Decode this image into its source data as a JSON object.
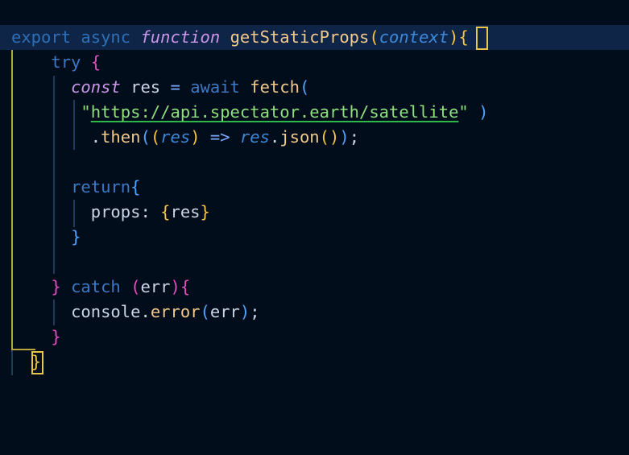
{
  "editor": {
    "lines": [
      [
        {
          "t": "export",
          "c": "#2f6fb6",
          "i": false
        },
        {
          "t": " ",
          "c": "#c9d6e6",
          "i": false
        },
        {
          "t": "async",
          "c": "#2f6fb6",
          "i": false
        },
        {
          "t": " ",
          "c": "#c9d6e6",
          "i": false
        },
        {
          "t": "function",
          "c": "#c996e8",
          "i": true
        },
        {
          "t": " ",
          "c": "#c9d6e6",
          "i": false
        },
        {
          "t": "getStaticProps",
          "c": "#f2c98a",
          "i": false
        },
        {
          "t": "(",
          "c": "#f6c344",
          "i": false
        },
        {
          "t": "context",
          "c": "#3d88d8",
          "i": true
        },
        {
          "t": ")",
          "c": "#f6c344",
          "i": false
        },
        {
          "t": "{",
          "c": "#f6c344",
          "i": false
        }
      ],
      [
        {
          "t": "    ",
          "c": "#c9d6e6",
          "i": false
        },
        {
          "t": "try",
          "c": "#3b79c4",
          "i": false
        },
        {
          "t": " ",
          "c": "#c9d6e6",
          "i": false
        },
        {
          "t": "{",
          "c": "#e04fc0",
          "i": false
        }
      ],
      [
        {
          "t": "      ",
          "c": "#c9d6e6",
          "i": false
        },
        {
          "t": "const",
          "c": "#c996e8",
          "i": true
        },
        {
          "t": " ",
          "c": "#c9d6e6",
          "i": false
        },
        {
          "t": "res",
          "c": "#c9d6e6",
          "i": false
        },
        {
          "t": " = ",
          "c": "#7aa8ff",
          "i": false
        },
        {
          "t": "await",
          "c": "#3b79c4",
          "i": false
        },
        {
          "t": " ",
          "c": "#c9d6e6",
          "i": false
        },
        {
          "t": "fetch",
          "c": "#f2c98a",
          "i": false
        },
        {
          "t": "(",
          "c": "#4ea3ff",
          "i": false
        }
      ],
      [
        {
          "t": "       ",
          "c": "#c9d6e6",
          "i": false
        },
        {
          "t": "\"",
          "c": "#8fe07d",
          "i": false
        },
        {
          "t": "https://api.spectator.earth/satellite",
          "c": "#8fe07d",
          "i": false
        },
        {
          "t": "\"",
          "c": "#8fe07d",
          "i": false
        },
        {
          "t": " ",
          "c": "#c9d6e6",
          "i": false
        },
        {
          "t": ")",
          "c": "#4ea3ff",
          "i": false
        }
      ],
      [
        {
          "t": "        ",
          "c": "#c9d6e6",
          "i": false
        },
        {
          "t": ".",
          "c": "#c9d6e6",
          "i": false
        },
        {
          "t": "then",
          "c": "#f2c98a",
          "i": false
        },
        {
          "t": "(",
          "c": "#4ea3ff",
          "i": false
        },
        {
          "t": "(",
          "c": "#f6c344",
          "i": false
        },
        {
          "t": "res",
          "c": "#3d88d8",
          "i": true
        },
        {
          "t": ")",
          "c": "#f6c344",
          "i": false
        },
        {
          "t": " => ",
          "c": "#7aa8ff",
          "i": false
        },
        {
          "t": "res",
          "c": "#3d88d8",
          "i": true
        },
        {
          "t": ".",
          "c": "#c9d6e6",
          "i": false
        },
        {
          "t": "json",
          "c": "#f2c98a",
          "i": false
        },
        {
          "t": "()",
          "c": "#f6c344",
          "i": false
        },
        {
          "t": ")",
          "c": "#4ea3ff",
          "i": false
        },
        {
          "t": ";",
          "c": "#c9d6e6",
          "i": false
        }
      ],
      [],
      [
        {
          "t": "      ",
          "c": "#c9d6e6",
          "i": false
        },
        {
          "t": "return",
          "c": "#3b79c4",
          "i": false
        },
        {
          "t": "{",
          "c": "#4ea3ff",
          "i": false
        }
      ],
      [
        {
          "t": "        ",
          "c": "#c9d6e6",
          "i": false
        },
        {
          "t": "props",
          "c": "#c9d6e6",
          "i": false
        },
        {
          "t": ": ",
          "c": "#c9d6e6",
          "i": false
        },
        {
          "t": "{",
          "c": "#f6c344",
          "i": false
        },
        {
          "t": "res",
          "c": "#c9d6e6",
          "i": false
        },
        {
          "t": "}",
          "c": "#f6c344",
          "i": false
        }
      ],
      [
        {
          "t": "      ",
          "c": "#c9d6e6",
          "i": false
        },
        {
          "t": "}",
          "c": "#4ea3ff",
          "i": false
        }
      ],
      [],
      [
        {
          "t": "    ",
          "c": "#c9d6e6",
          "i": false
        },
        {
          "t": "}",
          "c": "#e04fc0",
          "i": false
        },
        {
          "t": " ",
          "c": "#c9d6e6",
          "i": false
        },
        {
          "t": "catch",
          "c": "#3b79c4",
          "i": false
        },
        {
          "t": " ",
          "c": "#c9d6e6",
          "i": false
        },
        {
          "t": "(",
          "c": "#e04fc0",
          "i": false
        },
        {
          "t": "err",
          "c": "#c9d6e6",
          "i": false
        },
        {
          "t": ")",
          "c": "#e04fc0",
          "i": false
        },
        {
          "t": "{",
          "c": "#e04fc0",
          "i": false
        }
      ],
      [
        {
          "t": "      ",
          "c": "#c9d6e6",
          "i": false
        },
        {
          "t": "console",
          "c": "#c9d6e6",
          "i": false
        },
        {
          "t": ".",
          "c": "#c9d6e6",
          "i": false
        },
        {
          "t": "error",
          "c": "#f2c98a",
          "i": false
        },
        {
          "t": "(",
          "c": "#4ea3ff",
          "i": false
        },
        {
          "t": "err",
          "c": "#c9d6e6",
          "i": false
        },
        {
          "t": ")",
          "c": "#4ea3ff",
          "i": false
        },
        {
          "t": ";",
          "c": "#c9d6e6",
          "i": false
        }
      ],
      [
        {
          "t": "    ",
          "c": "#c9d6e6",
          "i": false
        },
        {
          "t": "}",
          "c": "#e04fc0",
          "i": false
        }
      ],
      [
        {
          "t": "  ",
          "c": "#c9d6e6",
          "i": false
        },
        {
          "t": "}",
          "c": "#f6c344",
          "i": false
        }
      ]
    ],
    "colors": {
      "background": "#020d1c",
      "current_line": "#0e2548",
      "active_guide": "#b7a63a",
      "guide": "#1e3a5c",
      "link_underline": "#2fb84a",
      "bracket_match": "#e8c64a"
    }
  }
}
